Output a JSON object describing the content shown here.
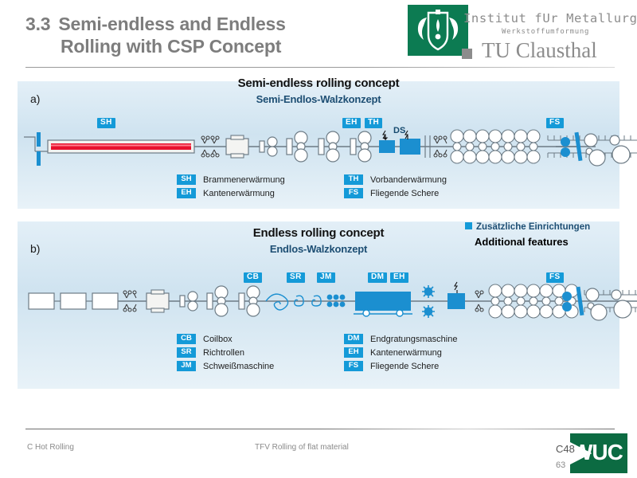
{
  "slide": {
    "title_number": "3.3",
    "title_line1": "Semi-endless and Endless",
    "title_line2": "Rolling with CSP Concept"
  },
  "logo": {
    "line1": "Institut fUr Metallurg",
    "line2": "Werkstoffumformung",
    "line3": "TU Clausthal",
    "crest_color": "#0c7b52"
  },
  "figure_a": {
    "tag": "a)",
    "heading_en": "Semi-endless rolling concept",
    "heading_de": "Semi-Endlos-Walzkonzept",
    "diagram_labels": [
      {
        "text": "SH",
        "type": "badge"
      },
      {
        "text": "EH",
        "type": "badge"
      },
      {
        "text": "TH",
        "type": "badge"
      },
      {
        "text": "DS",
        "type": "plain"
      },
      {
        "text": "FS",
        "type": "badge"
      }
    ],
    "legend_left": [
      {
        "key": "SH",
        "value": "Brammenerwärmung"
      },
      {
        "key": "EH",
        "value": "Kantenerwärmung"
      }
    ],
    "legend_right": [
      {
        "key": "TH",
        "value": "Vorbanderwärmung"
      },
      {
        "key": "FS",
        "value": "Fliegende Schere"
      }
    ]
  },
  "figure_b": {
    "tag": "b)",
    "heading_en": "Endless rolling concept",
    "heading_de": "Endlos-Walzkonzept",
    "diagram_labels": [
      {
        "text": "CB",
        "type": "badge"
      },
      {
        "text": "SR",
        "type": "badge"
      },
      {
        "text": "JM",
        "type": "badge"
      },
      {
        "text": "DM",
        "type": "badge"
      },
      {
        "text": "EH",
        "type": "badge"
      },
      {
        "text": "FS",
        "type": "badge"
      }
    ],
    "legend_left": [
      {
        "key": "CB",
        "value": "Coilbox"
      },
      {
        "key": "SR",
        "value": "Richtrollen"
      },
      {
        "key": "JM",
        "value": "Schweißmaschine"
      }
    ],
    "legend_right": [
      {
        "key": "DM",
        "value": "Endgratungsmaschine"
      },
      {
        "key": "EH",
        "value": "Kantenerwärmung"
      },
      {
        "key": "FS",
        "value": "Fliegende Schere"
      }
    ]
  },
  "additional_features": {
    "de": "Zusätzliche Einrichtungen",
    "en": "Additional features",
    "swatch_color": "#149ad8"
  },
  "footer": {
    "left": "C Hot Rolling",
    "center": "TFV Rolling of flat material",
    "code": "C48",
    "page": "63",
    "logo_text": "WUC",
    "logo_color": "#0c6b42"
  },
  "colors": {
    "badge": "#149ad8",
    "title_gray": "#7d7d7d",
    "heading_de_blue": "#1d4e73",
    "hot_slab": "#e8102d",
    "panel_bg_top": "#e3eff7"
  }
}
